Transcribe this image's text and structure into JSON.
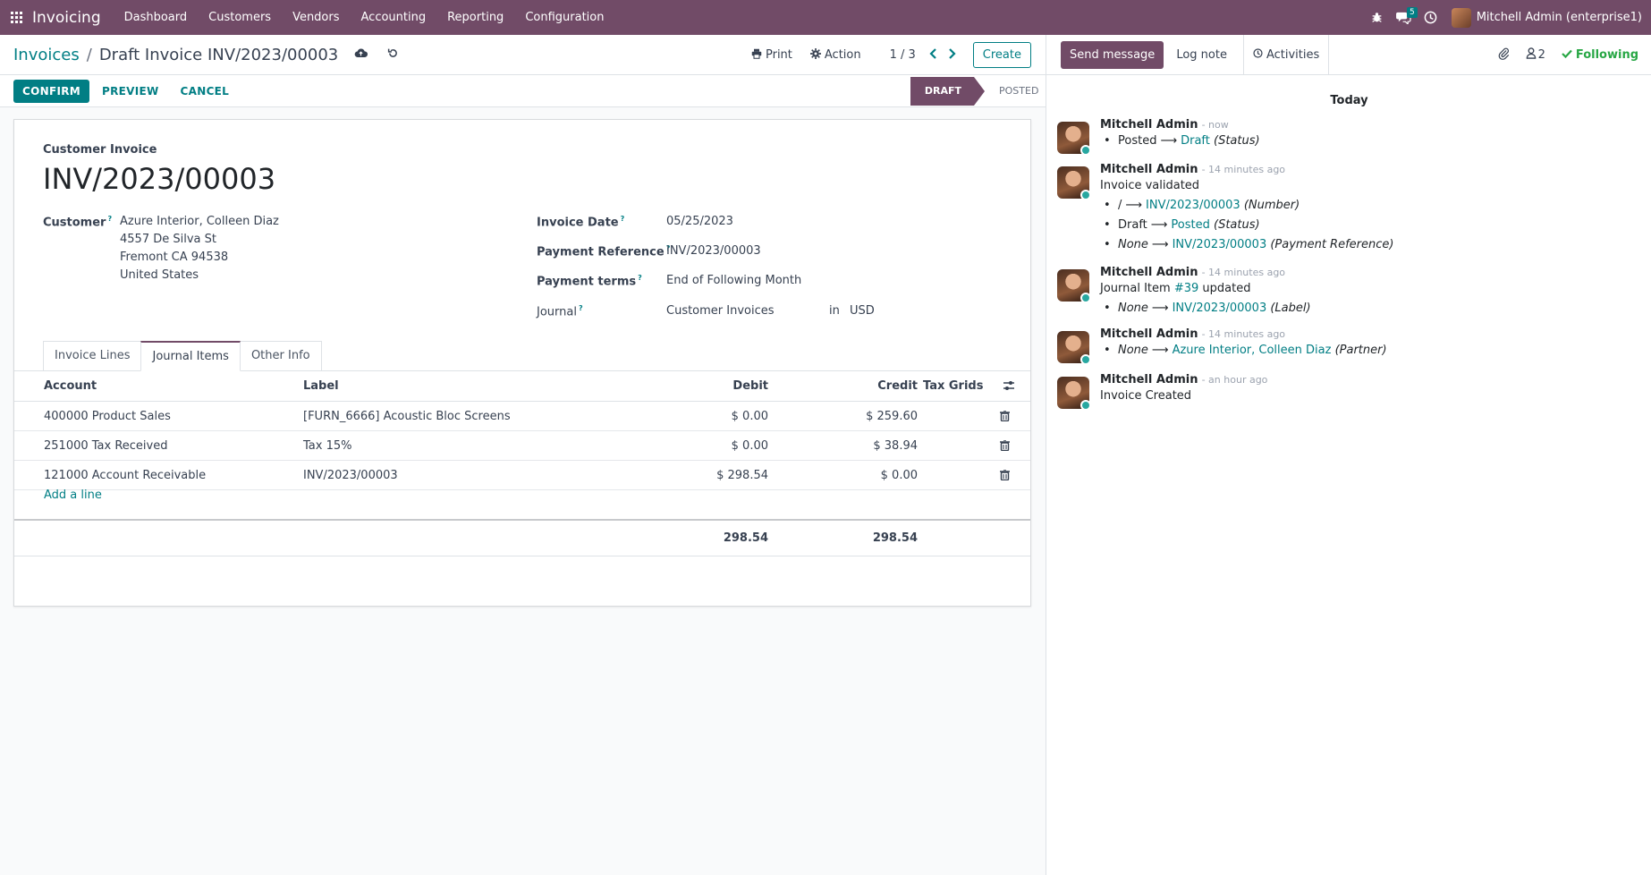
{
  "navbar": {
    "app_name": "Invoicing",
    "menu": [
      "Dashboard",
      "Customers",
      "Vendors",
      "Accounting",
      "Reporting",
      "Configuration"
    ],
    "messages_badge": "5",
    "user": "Mitchell Admin (enterprise1)"
  },
  "control": {
    "breadcrumb_parent": "Invoices",
    "breadcrumb_sep": "/",
    "breadcrumb_current": "Draft Invoice INV/2023/00003",
    "print": "Print",
    "action": "Action",
    "pager": "1 / 3",
    "create": "Create",
    "confirm": "CONFIRM",
    "preview": "PREVIEW",
    "cancel": "CANCEL",
    "stage_draft": "DRAFT",
    "stage_posted": "POSTED"
  },
  "invoice": {
    "type_label": "Customer Invoice",
    "number": "INV/2023/00003",
    "customer_label": "Customer",
    "customer_lines": [
      "Azure Interior, Colleen Diaz",
      "4557 De Silva St",
      "Fremont CA 94538",
      "United States"
    ],
    "invoice_date_label": "Invoice Date",
    "invoice_date": "05/25/2023",
    "payment_ref_label": "Payment Reference",
    "payment_ref": "INV/2023/00003",
    "payment_terms_label": "Payment terms",
    "payment_terms": "End of Following Month",
    "journal_label": "Journal",
    "journal": "Customer Invoices",
    "journal_in": "in",
    "currency": "USD",
    "help_mark": "?"
  },
  "tabs": [
    "Invoice Lines",
    "Journal Items",
    "Other Info"
  ],
  "journal_table": {
    "headers": {
      "account": "Account",
      "label": "Label",
      "debit": "Debit",
      "credit": "Credit",
      "tax_grids": "Tax Grids"
    },
    "rows": [
      {
        "account": "400000 Product Sales",
        "label": "[FURN_6666] Acoustic Bloc Screens",
        "debit": "$ 0.00",
        "credit": "$ 259.60"
      },
      {
        "account": "251000 Tax Received",
        "label": "Tax 15%",
        "debit": "$ 0.00",
        "credit": "$ 38.94"
      },
      {
        "account": "121000 Account Receivable",
        "label": "INV/2023/00003",
        "debit": "$ 298.54",
        "credit": "$ 0.00"
      }
    ],
    "add_line": "Add a line",
    "total_debit": "298.54",
    "total_credit": "298.54"
  },
  "chatter": {
    "send_message": "Send message",
    "log_note": "Log note",
    "activities": "Activities",
    "followers_count": "2",
    "following": "Following",
    "today": "Today",
    "author": "Mitchell Admin",
    "messages": [
      {
        "ago": "- now"
      },
      {
        "ago": "- 14 minutes ago",
        "text": "Invoice validated"
      },
      {
        "ago": "- 14 minutes ago",
        "text_prefix": "Journal Item ",
        "text_link": "#39",
        "text_suffix": " updated"
      },
      {
        "ago": "- 14 minutes ago"
      },
      {
        "ago": "- an hour ago",
        "text": "Invoice Created"
      }
    ],
    "changes": {
      "m1": [
        {
          "old": "Posted",
          "new": "Draft",
          "field": "(Status)"
        }
      ],
      "m2": [
        {
          "old": "/",
          "new": "INV/2023/00003",
          "field": "(Number)"
        },
        {
          "old": "Draft",
          "new": "Posted",
          "field": "(Status)"
        },
        {
          "old": "None",
          "new": "INV/2023/00003",
          "field": "(Payment Reference)"
        }
      ],
      "m3": [
        {
          "old": "None",
          "new": "INV/2023/00003",
          "field": "(Label)"
        }
      ],
      "m4": [
        {
          "old": "None",
          "new": "Azure Interior, Colleen Diaz",
          "field": "(Partner)"
        }
      ]
    },
    "arrow_glyph": "⟶"
  },
  "colors": {
    "brand": "#714b67",
    "accent": "#017e84",
    "following": "#28a745"
  }
}
